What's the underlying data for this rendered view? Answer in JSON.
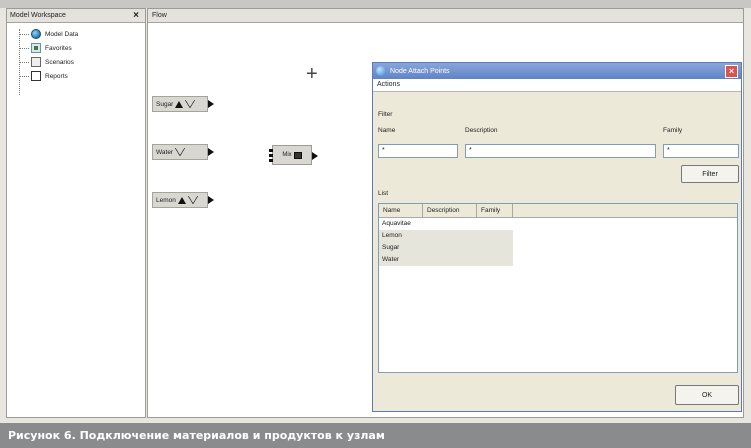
{
  "workspace": {
    "title": "Model Workspace",
    "close_label": "×",
    "tree": [
      {
        "label": "Model Data",
        "icon": "globe-icon"
      },
      {
        "label": "Favorites",
        "icon": "favorites-icon"
      },
      {
        "label": "Scenarios",
        "icon": "scenarios-icon"
      },
      {
        "label": "Reports",
        "icon": "reports-icon"
      }
    ]
  },
  "flow": {
    "title": "Flow",
    "nodes": [
      {
        "label": "Sugar"
      },
      {
        "label": "Water"
      },
      {
        "label": "Lemon"
      }
    ],
    "process": {
      "label": "Mix"
    }
  },
  "dialog": {
    "title": "Node Attach Points",
    "close_label": "×",
    "menu": "Actions",
    "filter_group": "Filter",
    "name_label": "Name",
    "name_value": "*",
    "description_label": "Description",
    "description_value": "*",
    "family_label": "Family",
    "family_value": "*",
    "filter_button": "Filter",
    "list_group": "List",
    "columns": [
      "Name",
      "Description",
      "Family"
    ],
    "rows": [
      "Aquavitae",
      "Lemon",
      "Sugar",
      "Water"
    ],
    "ok_button": "OK"
  },
  "caption": "Рисунок 6. Подключение материалов и продуктов к узлам"
}
